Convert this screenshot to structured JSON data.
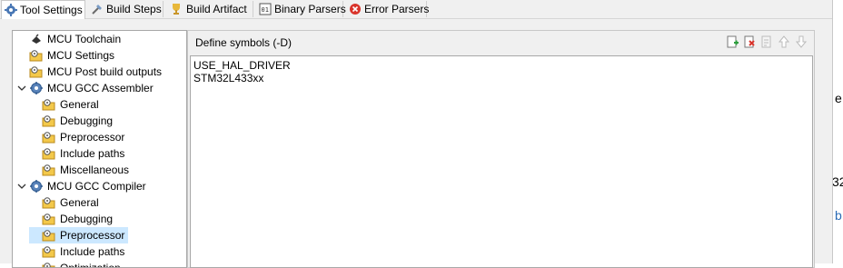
{
  "tabs": [
    {
      "label": "Tool Settings",
      "icon": "tool-settings-icon",
      "active": true
    },
    {
      "label": "Build Steps",
      "icon": "build-steps-icon",
      "active": false
    },
    {
      "label": "Build Artifact",
      "icon": "trophy-icon",
      "active": false
    },
    {
      "label": "Binary Parsers",
      "icon": "binary-icon",
      "active": false
    },
    {
      "label": "Error Parsers",
      "icon": "error-icon",
      "active": false
    }
  ],
  "tree": [
    {
      "label": "MCU Toolchain",
      "level": 1,
      "expanded": null,
      "selected": false,
      "icon": "chip-icon"
    },
    {
      "label": "MCU Settings",
      "level": 1,
      "expanded": null,
      "selected": false,
      "icon": "settings-folder-icon"
    },
    {
      "label": "MCU Post build outputs",
      "level": 1,
      "expanded": null,
      "selected": false,
      "icon": "settings-folder-icon"
    },
    {
      "label": "MCU GCC Assembler",
      "level": 1,
      "expanded": true,
      "selected": false,
      "icon": "tool-gear-icon"
    },
    {
      "label": "General",
      "level": 2,
      "expanded": null,
      "selected": false,
      "icon": "settings-folder-icon"
    },
    {
      "label": "Debugging",
      "level": 2,
      "expanded": null,
      "selected": false,
      "icon": "settings-folder-icon"
    },
    {
      "label": "Preprocessor",
      "level": 2,
      "expanded": null,
      "selected": false,
      "icon": "settings-folder-icon"
    },
    {
      "label": "Include paths",
      "level": 2,
      "expanded": null,
      "selected": false,
      "icon": "settings-folder-icon"
    },
    {
      "label": "Miscellaneous",
      "level": 2,
      "expanded": null,
      "selected": false,
      "icon": "settings-folder-icon"
    },
    {
      "label": "MCU GCC Compiler",
      "level": 1,
      "expanded": true,
      "selected": false,
      "icon": "tool-gear-icon"
    },
    {
      "label": "General",
      "level": 2,
      "expanded": null,
      "selected": false,
      "icon": "settings-folder-icon"
    },
    {
      "label": "Debugging",
      "level": 2,
      "expanded": null,
      "selected": false,
      "icon": "settings-folder-icon"
    },
    {
      "label": "Preprocessor",
      "level": 2,
      "expanded": null,
      "selected": true,
      "icon": "settings-folder-icon"
    },
    {
      "label": "Include paths",
      "level": 2,
      "expanded": null,
      "selected": false,
      "icon": "settings-folder-icon"
    },
    {
      "label": "Optimization",
      "level": 2,
      "expanded": null,
      "selected": false,
      "icon": "settings-folder-icon"
    }
  ],
  "panel": {
    "title": "Define symbols (-D)",
    "tools": [
      {
        "name": "add-symbol-icon",
        "enabled": true
      },
      {
        "name": "delete-symbol-icon",
        "enabled": true
      },
      {
        "name": "edit-symbol-icon",
        "enabled": false
      },
      {
        "name": "move-up-icon",
        "enabled": false
      },
      {
        "name": "move-down-icon",
        "enabled": false
      }
    ],
    "symbols": [
      "USE_HAL_DRIVER",
      "STM32L433xx"
    ]
  },
  "edge_fragments": [
    "e",
    "32",
    "b"
  ],
  "colors": {
    "tab_bg": "#f0f0f0",
    "selection": "#cce8ff",
    "border": "#a8a8a8",
    "folder": "#e8b83a"
  }
}
